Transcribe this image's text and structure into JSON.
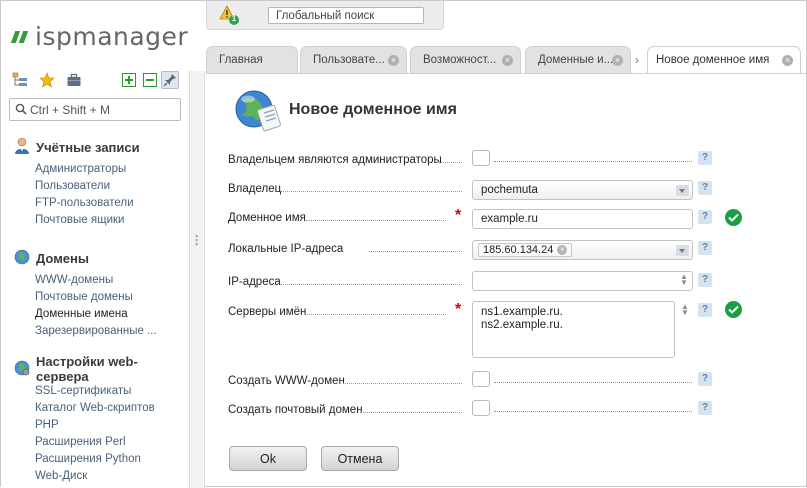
{
  "app": {
    "logo_text": "ispmanager"
  },
  "topbar": {
    "warning_count": "1",
    "search_placeholder": "Глобальный поиск"
  },
  "sidebar": {
    "search_placeholder": "Ctrl + Shift + M",
    "groups": [
      {
        "title": "Учётные записи",
        "icon": "users-icon",
        "items": [
          "Администраторы",
          "Пользователи",
          "FTP-пользователи",
          "Почтовые ящики"
        ]
      },
      {
        "title": "Домены",
        "icon": "globe-icon",
        "items": [
          "WWW-домены",
          "Почтовые домены",
          "Доменные имена",
          "Зарезервированные ..."
        ]
      },
      {
        "title": "Настройки web-сервера",
        "icon": "globe-gear-icon",
        "items": [
          "SSL-сертификаты",
          "Каталог Web-скриптов",
          "PHP",
          "Расширения Perl",
          "Расширения Python",
          "Web-Диск"
        ]
      }
    ],
    "active_item": "Доменные имена"
  },
  "tabs": [
    {
      "label": "Главная",
      "closable": false,
      "active": false
    },
    {
      "label": "Пользовате...",
      "closable": true,
      "active": false
    },
    {
      "label": "Возможност...",
      "closable": true,
      "active": false
    },
    {
      "label": "Доменные и...",
      "closable": true,
      "active": false
    },
    {
      "label": "Новое доменное имя",
      "closable": true,
      "active": true
    }
  ],
  "form": {
    "title": "Новое доменное имя",
    "fields": {
      "admin_owner": {
        "label": "Владельцем являются администраторы",
        "checked": false
      },
      "owner": {
        "label": "Владелец",
        "value": "pochemuta"
      },
      "domain": {
        "label": "Доменное имя",
        "value": "example.ru",
        "required": true,
        "valid": true
      },
      "local_ip": {
        "label": "Локальные IP-адреса",
        "value": "185.60.134.24"
      },
      "ip": {
        "label": "IP-адреса",
        "value": ""
      },
      "ns": {
        "label": "Серверы имён",
        "value": "ns1.example.ru.\nns2.example.ru.",
        "required": true,
        "valid": true
      },
      "www_domain": {
        "label": "Создать WWW-домен",
        "checked": false
      },
      "mail_domain": {
        "label": "Создать почтовый домен",
        "checked": false
      }
    },
    "help_label": "?",
    "ok_label": "Ok",
    "cancel_label": "Отмена"
  },
  "colors": {
    "accent_green": "#1aa043",
    "required_red": "#d10000",
    "logo_green": "#3c9a3c"
  }
}
